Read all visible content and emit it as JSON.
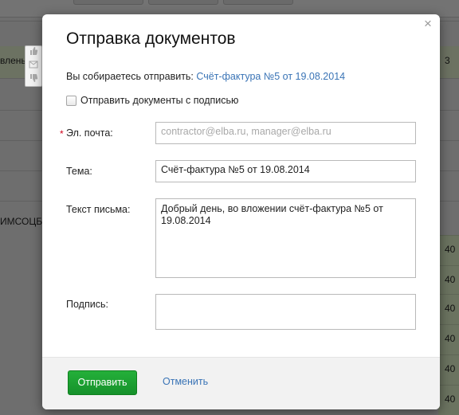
{
  "background": {
    "row_label_1": "вленьі",
    "row_label_2": "ИМСОЦБ",
    "side_numbers": [
      "3",
      "40",
      "40",
      "40",
      "40",
      "40",
      "40"
    ]
  },
  "modal": {
    "title": "Отправка документов",
    "close_glyph": "×",
    "intro_prefix": "Вы собираетесь отправить:",
    "document_link": "Счёт-фактура №5 от 19.08.2014",
    "sign_checkbox_label": "Отправить документы с подписью",
    "fields": {
      "email": {
        "label": "Эл. почта:",
        "required_mark": "*",
        "placeholder": "contractor@elba.ru, manager@elba.ru",
        "value": ""
      },
      "subject": {
        "label": "Тема:",
        "value": "Счёт-фактура №5 от 19.08.2014"
      },
      "body": {
        "label": "Текст письма:",
        "value": "Добрый день, во вложении счёт-фактура №5 от 19.08.2014"
      },
      "signature": {
        "label": "Подпись:",
        "value": ""
      }
    },
    "buttons": {
      "send": "Отправить",
      "cancel": "Отменить"
    }
  },
  "colors": {
    "accent_link": "#3a74b6",
    "send_button": "#1ea033",
    "required_star": "#d0021b"
  },
  "icons": [
    "thumbs-up-icon",
    "mail-icon",
    "thumbs-down-icon",
    "close-icon"
  ]
}
